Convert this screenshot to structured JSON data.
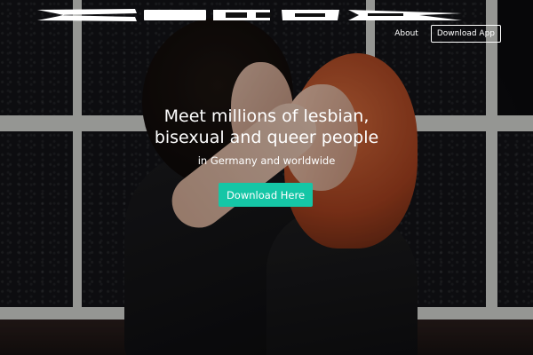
{
  "header": {
    "logo_name": "brand-logo",
    "nav": {
      "about_label": "About",
      "download_app_label": "Download App"
    }
  },
  "hero": {
    "headline_line1": "Meet millions of lesbian,",
    "headline_line2": "bisexual and queer people",
    "subheadline": "in Germany and worldwide",
    "cta_label": "Download Here",
    "cta_color": "#15c6a6",
    "text_color": "#ffffff"
  }
}
